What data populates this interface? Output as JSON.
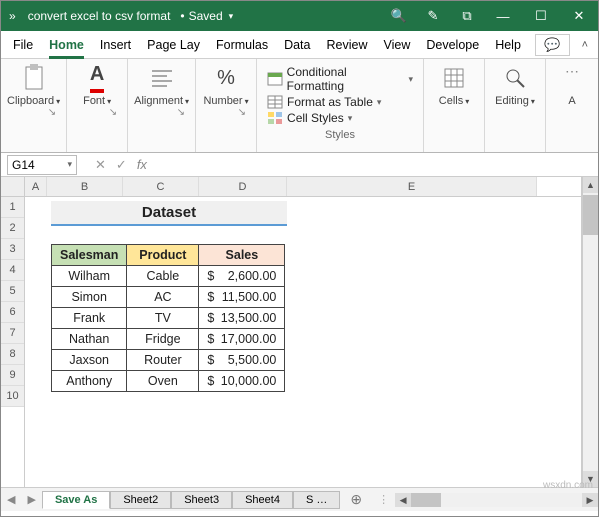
{
  "title": {
    "docname": "convert excel to csv format",
    "state": "Saved"
  },
  "menu": {
    "file": "File",
    "home": "Home",
    "insert": "Insert",
    "page": "Page Lay",
    "formulas": "Formulas",
    "data": "Data",
    "review": "Review",
    "view": "View",
    "developer": "Develope",
    "help": "Help"
  },
  "ribbon": {
    "clipboard": "Clipboard",
    "font": "Font",
    "alignment": "Alignment",
    "number": "Number",
    "styles": "Styles",
    "cond_fmt": "Conditional Formatting",
    "as_table": "Format as Table",
    "cell_styles": "Cell Styles",
    "cells": "Cells",
    "editing": "Editing"
  },
  "namebox": "G14",
  "columns": [
    "A",
    "B",
    "C",
    "D",
    "E"
  ],
  "rows": [
    "1",
    "2",
    "3",
    "4",
    "5",
    "6",
    "7",
    "8",
    "9",
    "10"
  ],
  "dataset_title": "Dataset",
  "headers": {
    "salesman": "Salesman",
    "product": "Product",
    "sales": "Sales"
  },
  "data": [
    {
      "salesman": "Wilham",
      "product": "Cable",
      "sales": "2,600.00"
    },
    {
      "salesman": "Simon",
      "product": "AC",
      "sales": "11,500.00"
    },
    {
      "salesman": "Frank",
      "product": "TV",
      "sales": "13,500.00"
    },
    {
      "salesman": "Nathan",
      "product": "Fridge",
      "sales": "17,000.00"
    },
    {
      "salesman": "Jaxson",
      "product": "Router",
      "sales": "5,500.00"
    },
    {
      "salesman": "Anthony",
      "product": "Oven",
      "sales": "10,000.00"
    }
  ],
  "currency": "$",
  "sheets": {
    "active": "Save As",
    "s2": "Sheet2",
    "s3": "Sheet3",
    "s4": "Sheet4",
    "s5": "S …"
  },
  "watermark": "wsxdn.com"
}
